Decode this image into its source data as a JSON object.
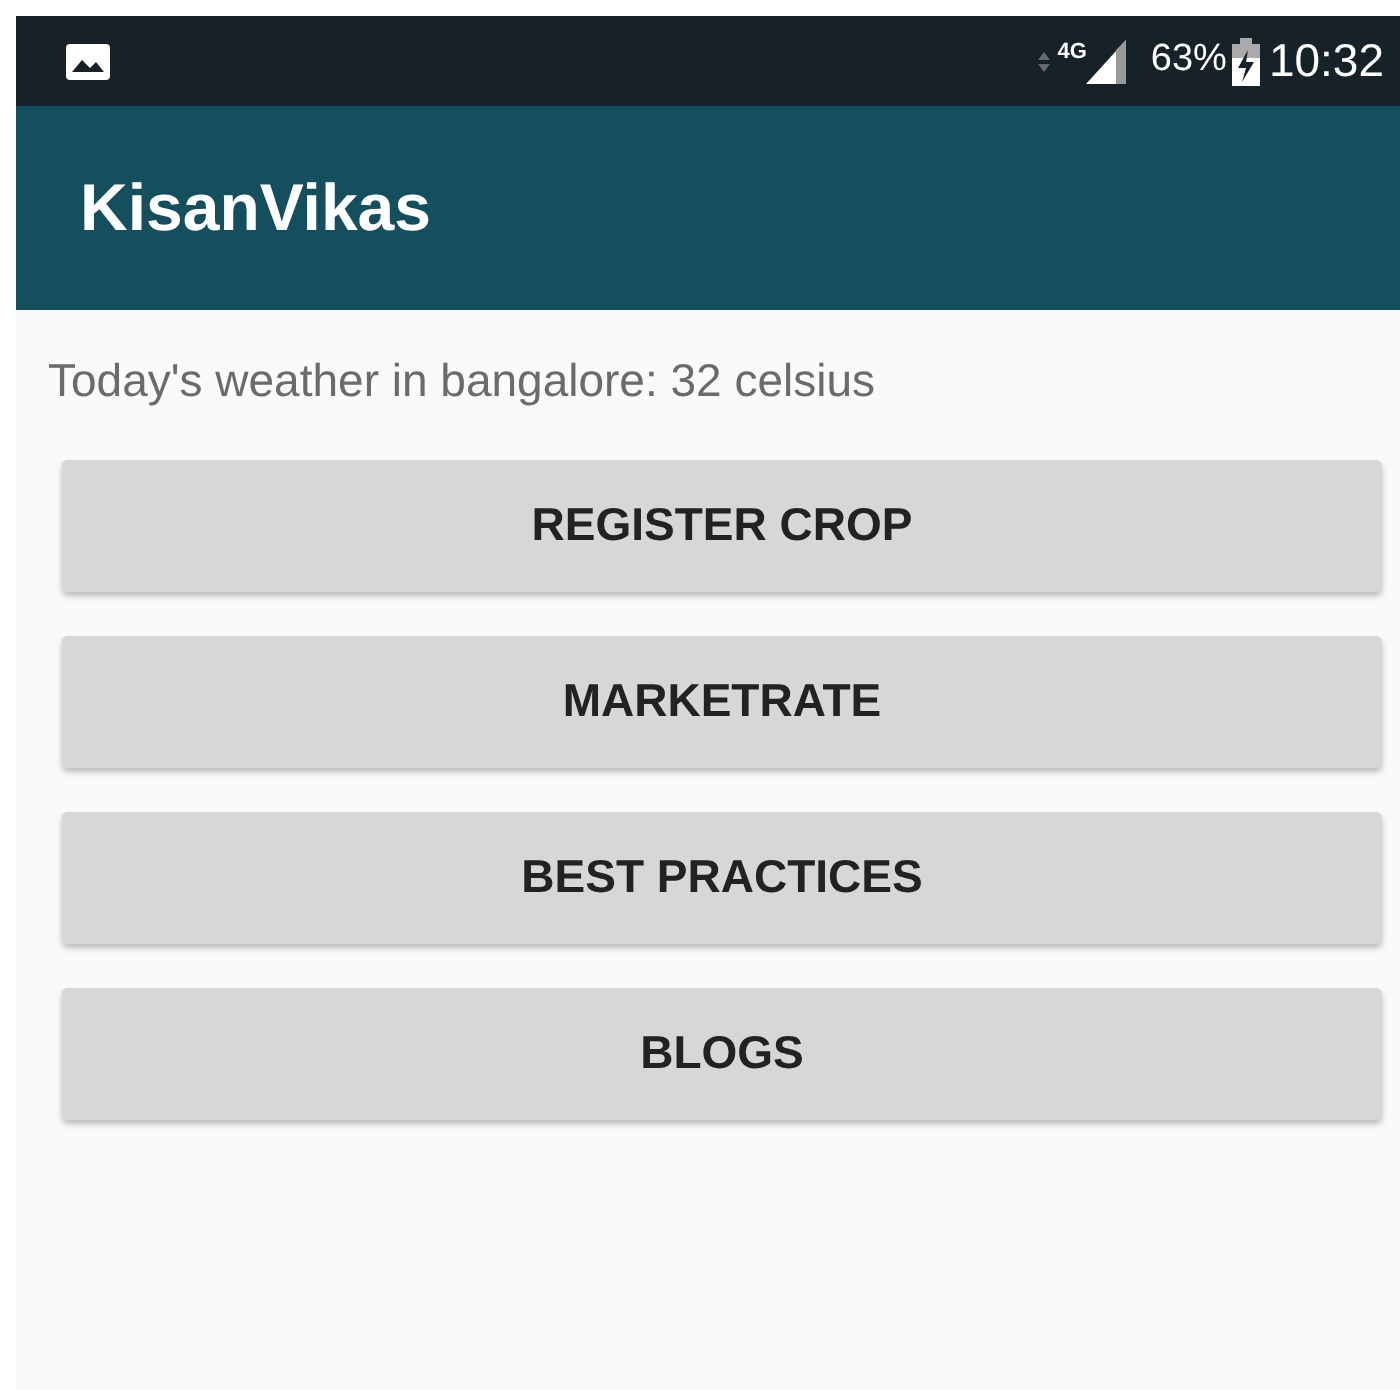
{
  "status_bar": {
    "network": "4G",
    "battery": "63%",
    "time": "10:32"
  },
  "app_bar": {
    "title": "KisanVikas"
  },
  "weather": "Today's weather in bangalore: 32 celsius",
  "buttons": [
    "REGISTER CROP",
    "MARKETRATE",
    "BEST PRACTICES",
    "BLOGS"
  ]
}
